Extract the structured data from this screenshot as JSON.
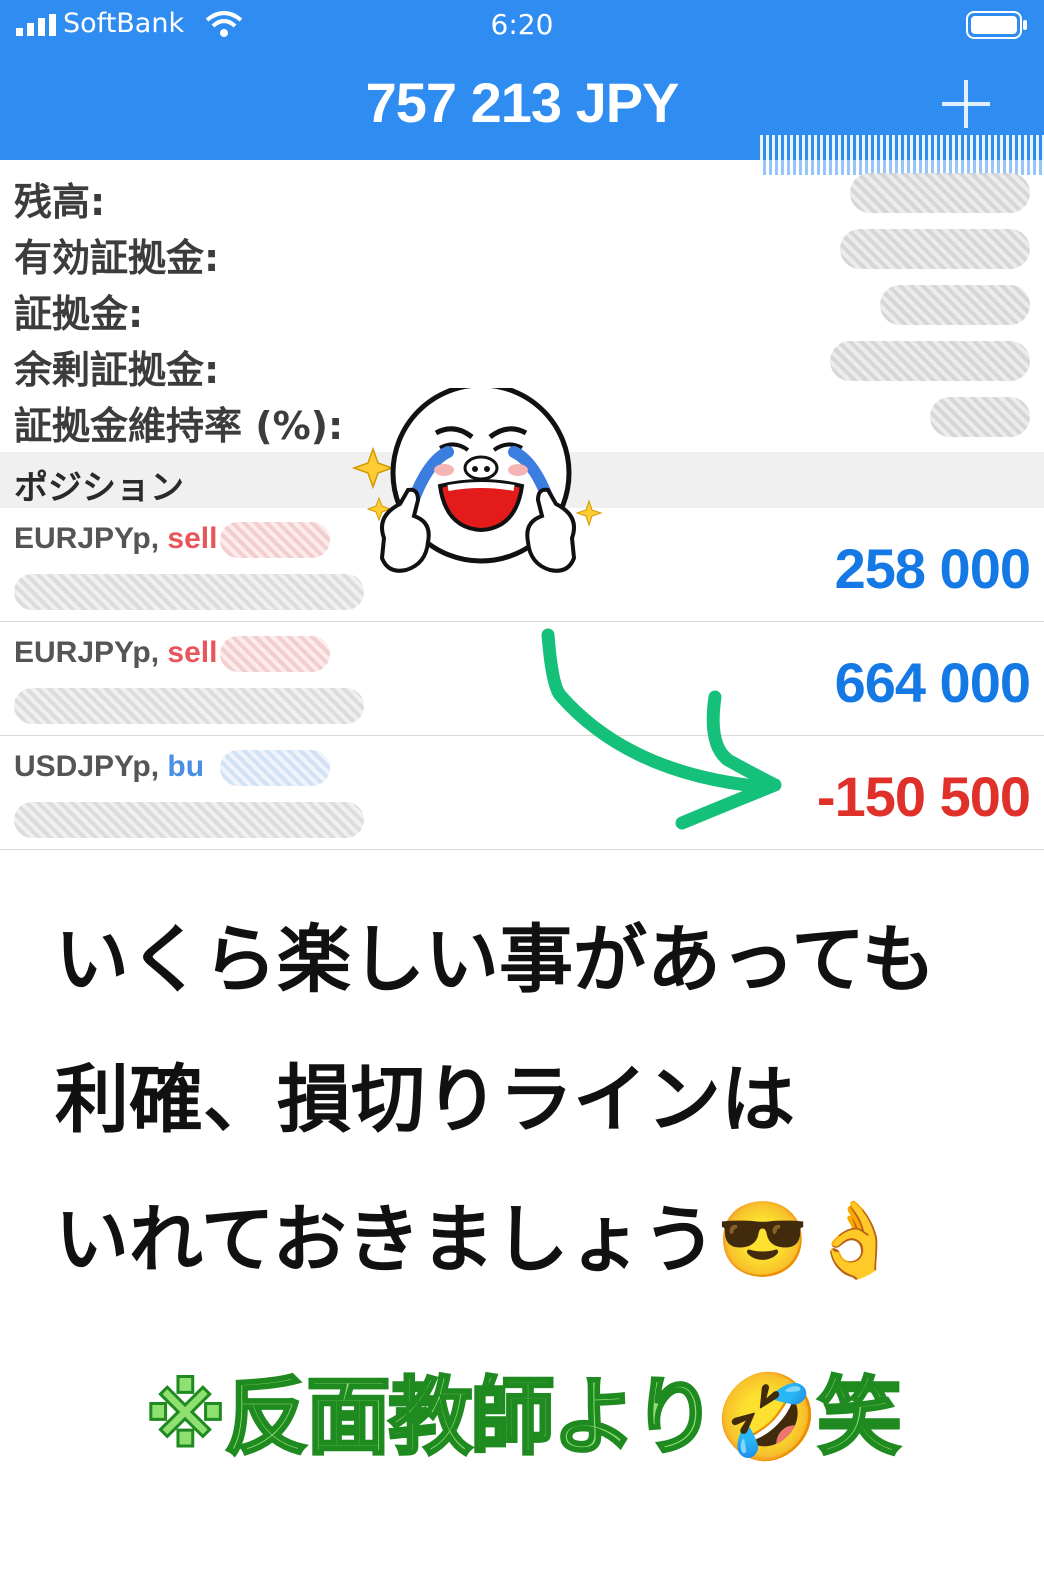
{
  "status_bar": {
    "carrier": "SoftBank",
    "time": "6:20"
  },
  "header": {
    "title": "757 213 JPY",
    "add_icon": "plus-icon"
  },
  "summary": [
    {
      "label": "残高:"
    },
    {
      "label": "有効証拠金:"
    },
    {
      "label": "証拠金:"
    },
    {
      "label": "余剰証拠金:"
    },
    {
      "label": "証拠金維持率 (%):"
    }
  ],
  "positions_section": {
    "label": "ポジション"
  },
  "positions": [
    {
      "symbol": "EURJPYp,",
      "side": "sell",
      "profit": "258 000",
      "profit_color": "#1479e4"
    },
    {
      "symbol": "EURJPYp,",
      "side": "sell",
      "profit": "664 000",
      "profit_color": "#1479e4"
    },
    {
      "symbol": "USDJPYp,",
      "side": "bu",
      "profit": "-150 500",
      "profit_color": "#e0302a"
    }
  ],
  "colors": {
    "side_sell": "#e8555a",
    "side_buy": "#4a90e2",
    "accent": "#2f8cf0"
  },
  "overlay": {
    "line1": "いくら楽しい事があっても",
    "line2": "利確、損切りラインは",
    "line3": "いれておきましょう😎👌",
    "footer": "※反面教師より🤣笑",
    "sticker": "laughing-crying-face-sticker",
    "arrow": "green-arrow"
  }
}
